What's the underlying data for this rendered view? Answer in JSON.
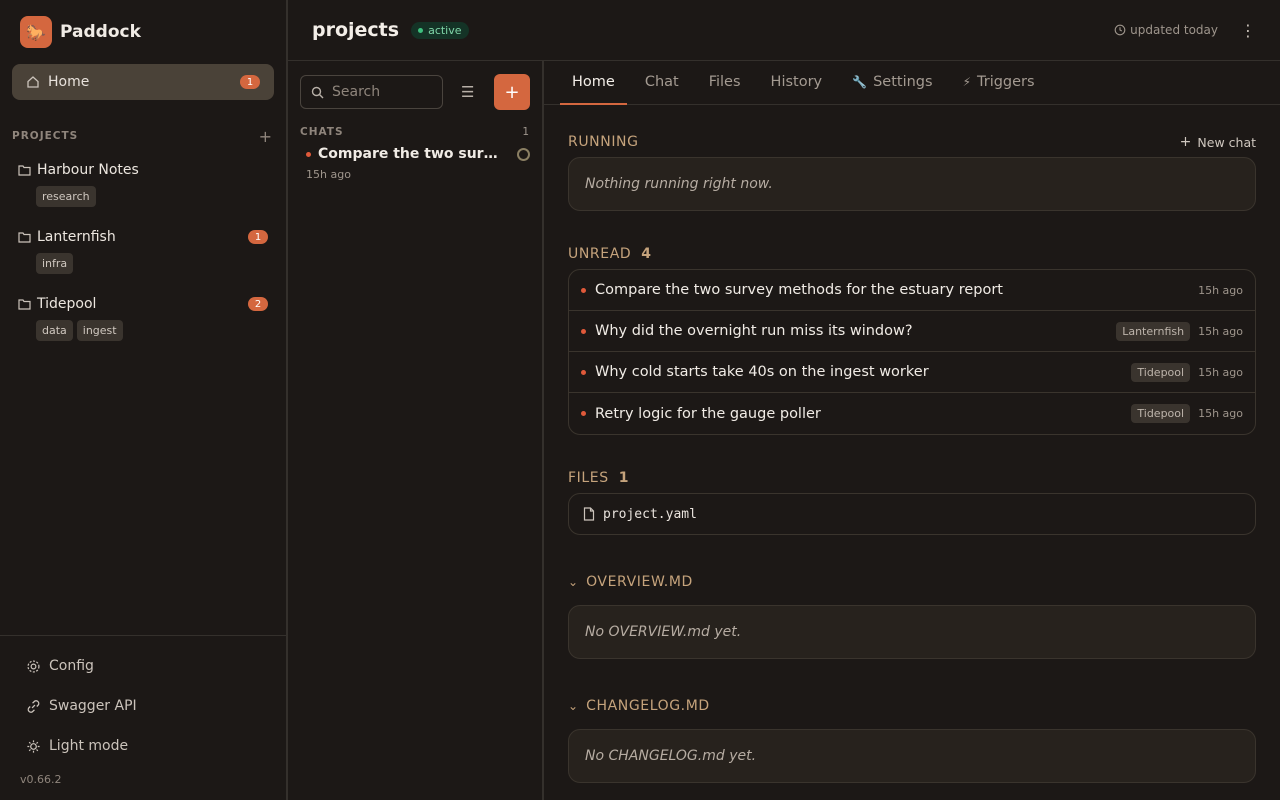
{
  "brand": {
    "name": "Paddock",
    "logo_icon": "horse-icon"
  },
  "sidebar": {
    "home": {
      "label": "Home",
      "badge": "1"
    },
    "projects_label": "PROJECTS",
    "projects": [
      {
        "name": "Harbour Notes",
        "badge": "",
        "tags": [
          "research"
        ]
      },
      {
        "name": "Lanternfish",
        "badge": "1",
        "tags": [
          "infra"
        ]
      },
      {
        "name": "Tidepool",
        "badge": "2",
        "tags": [
          "data",
          "ingest"
        ]
      }
    ],
    "footer": {
      "config": "Config",
      "swagger": "Swagger API",
      "light_mode": "Light mode",
      "version": "v0.66.2"
    }
  },
  "topbar": {
    "title": "projects",
    "status": "active",
    "updated": "updated today"
  },
  "chats_panel": {
    "search_placeholder": "Search",
    "section_label": "CHATS",
    "count": "1",
    "items": [
      {
        "title": "Compare the two survey methods for the estuary report",
        "time": "15h ago"
      }
    ]
  },
  "tabs": [
    {
      "label": "Home",
      "icon": ""
    },
    {
      "label": "Chat",
      "icon": ""
    },
    {
      "label": "Files",
      "icon": ""
    },
    {
      "label": "History",
      "icon": ""
    },
    {
      "label": "Settings",
      "icon": "wrench-icon"
    },
    {
      "label": "Triggers",
      "icon": "bolt-icon"
    }
  ],
  "home": {
    "running": {
      "title": "RUNNING",
      "new_chat": "New chat",
      "empty": "Nothing running right now."
    },
    "unread": {
      "title": "UNREAD",
      "count": "4",
      "items": [
        {
          "text": "Compare the two survey methods for the estuary report",
          "project": "",
          "time": "15h ago"
        },
        {
          "text": "Why did the overnight run miss its window?",
          "project": "Lanternfish",
          "time": "15h ago"
        },
        {
          "text": "Why cold starts take 40s on the ingest worker",
          "project": "Tidepool",
          "time": "15h ago"
        },
        {
          "text": "Retry logic for the gauge poller",
          "project": "Tidepool",
          "time": "15h ago"
        }
      ]
    },
    "files": {
      "title": "FILES",
      "count": "1",
      "items": [
        "project.yaml"
      ]
    },
    "overview": {
      "title": "OVERVIEW.MD",
      "empty": "No OVERVIEW.md yet."
    },
    "changelog": {
      "title": "CHANGELOG.MD",
      "empty": "No CHANGELOG.md yet."
    }
  },
  "colors": {
    "accent": "#d4673f",
    "active_green": "#3ec07e",
    "section_heading": "#c5a37c"
  }
}
